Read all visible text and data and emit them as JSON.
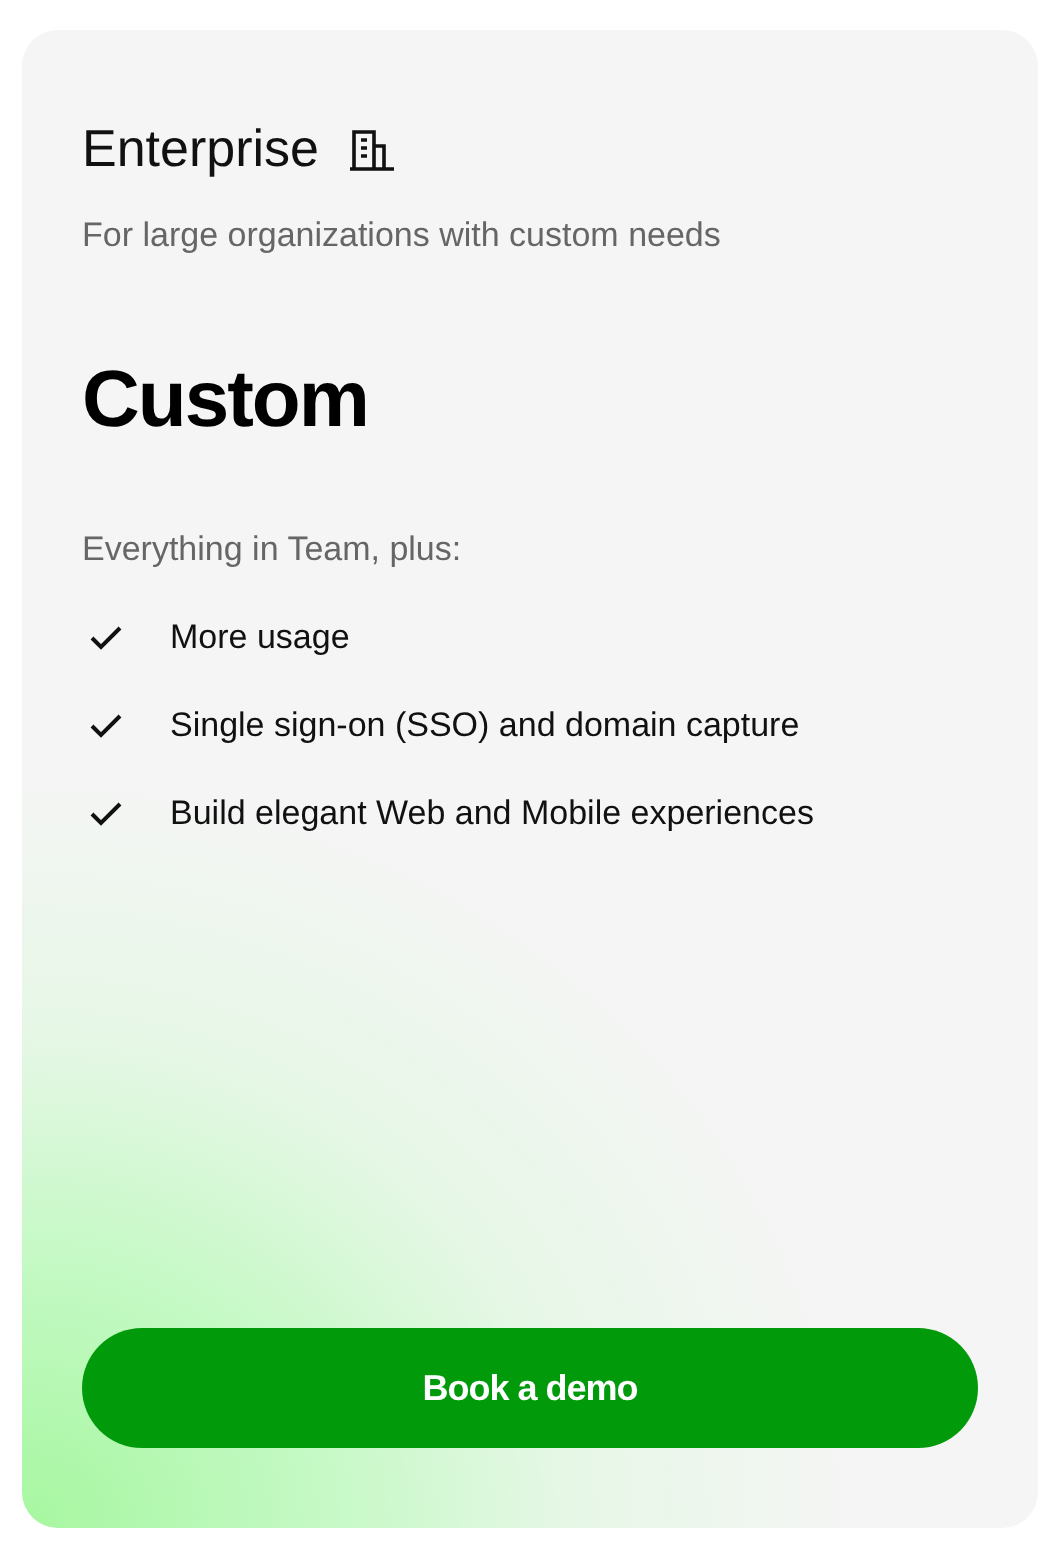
{
  "plan": {
    "name": "Enterprise",
    "description": "For large organizations with custom needs",
    "price": "Custom",
    "features_intro": "Everything in Team, plus:",
    "features": [
      "More usage",
      "Single sign-on (SSO) and domain capture",
      "Build elegant Web and Mobile experiences"
    ],
    "button": "Book a demo"
  }
}
